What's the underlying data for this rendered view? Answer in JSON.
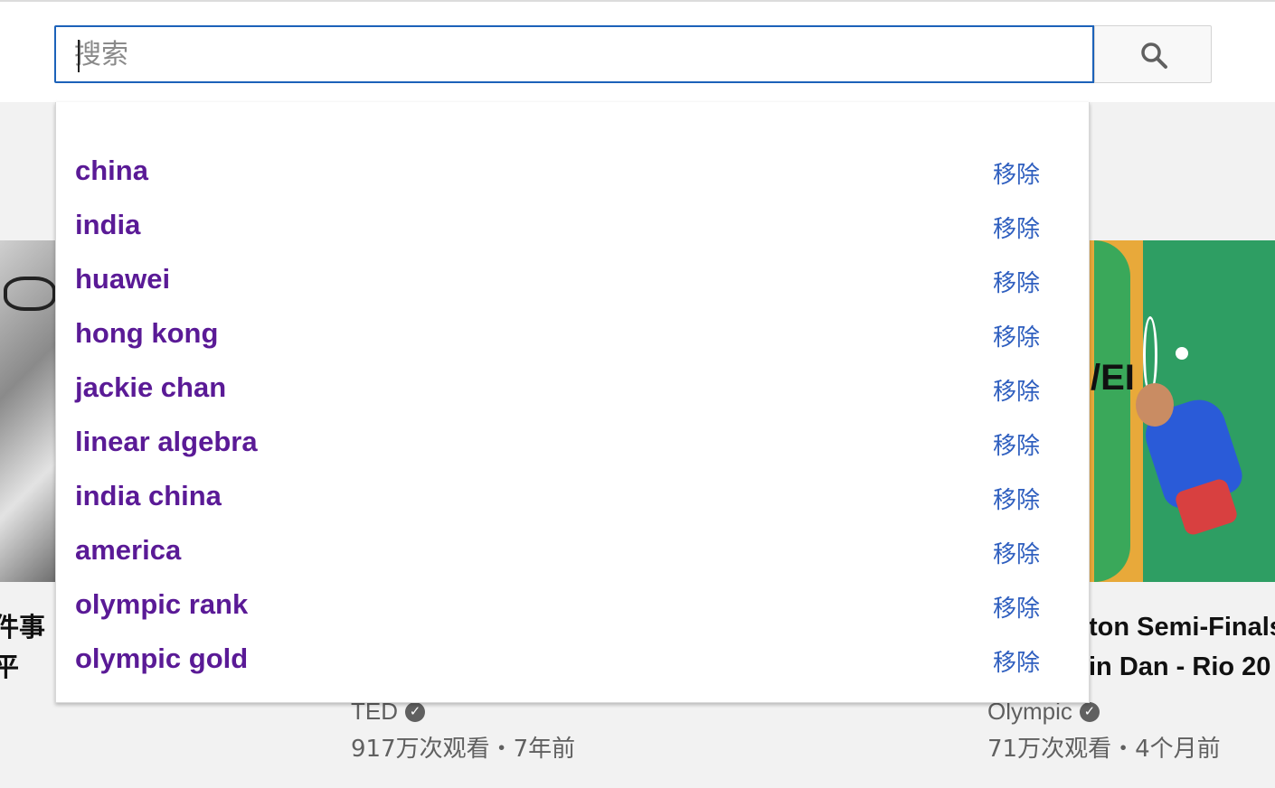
{
  "search": {
    "placeholder": "搜索",
    "button_icon": "search-icon"
  },
  "suggestions": [
    {
      "text": "china",
      "remove_label": "移除"
    },
    {
      "text": "india",
      "remove_label": "移除"
    },
    {
      "text": "huawei",
      "remove_label": "移除"
    },
    {
      "text": "hong kong",
      "remove_label": "移除"
    },
    {
      "text": "jackie chan",
      "remove_label": "移除"
    },
    {
      "text": "linear algebra",
      "remove_label": "移除"
    },
    {
      "text": "india china",
      "remove_label": "移除"
    },
    {
      "text": "america",
      "remove_label": "移除"
    },
    {
      "text": "olympic rank",
      "remove_label": "移除"
    },
    {
      "text": "olympic gold",
      "remove_label": "移除"
    }
  ],
  "videos": {
    "left": {
      "title_line1": "件事",
      "title_line2": "平",
      "channel": "TED",
      "meta": "917万次观看・7年前"
    },
    "right": {
      "title_line1": "ton Semi-Finals",
      "title_line2": "in Dan - Rio 20",
      "thumbnail_text": "/EI",
      "channel": "Olympic",
      "meta": "71万次观看・4个月前"
    }
  },
  "colors": {
    "suggestion_text": "#5a1a96",
    "remove_link": "#2f5fbf",
    "search_focus_border": "#1c62b9"
  }
}
